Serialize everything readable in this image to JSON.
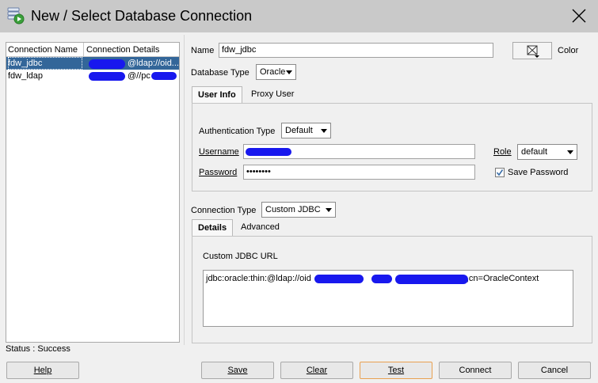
{
  "window": {
    "title": "New / Select Database Connection"
  },
  "connections": {
    "headers": [
      "Connection Name",
      "Connection Details"
    ],
    "rows": [
      {
        "name": "fdw_jdbc",
        "details": "@ldap://oid...",
        "selected": true
      },
      {
        "name": "fdw_ldap",
        "details": "@//pc",
        "selected": false
      }
    ]
  },
  "form": {
    "name_label": "Name",
    "name_value": "fdw_jdbc",
    "color_label": "Color",
    "db_type_label": "Database Type",
    "db_type_value": "Oracle",
    "tabs": [
      "User Info",
      "Proxy User"
    ],
    "auth_type_label": "Authentication Type",
    "auth_type_value": "Default",
    "username_label": "Username",
    "username_value": "",
    "password_label": "Password",
    "password_value": "••••••••",
    "role_label": "Role",
    "role_value": "default",
    "save_password_label": "Save Password",
    "save_password_checked": true,
    "conn_type_label": "Connection Type",
    "conn_type_value": "Custom JDBC",
    "conn_tabs": [
      "Details",
      "Advanced"
    ],
    "url_label": "Custom JDBC URL",
    "url_value_start": "jdbc:oracle:thin:@ldap://oid",
    "url_value_end": ",cn=OracleContext"
  },
  "status": {
    "text": "Status : Success"
  },
  "buttons": {
    "help": "Help",
    "save": "Save",
    "clear": "Clear",
    "test": "Test",
    "connect": "Connect",
    "cancel": "Cancel"
  },
  "colors": {
    "selection": "#336699",
    "redaction": "#1818ee",
    "focus_border": "#e8a050"
  },
  "icons": [
    "database-connection-icon",
    "close-icon",
    "color-picker-icon",
    "checkmark-icon",
    "chevron-down-icon"
  ]
}
